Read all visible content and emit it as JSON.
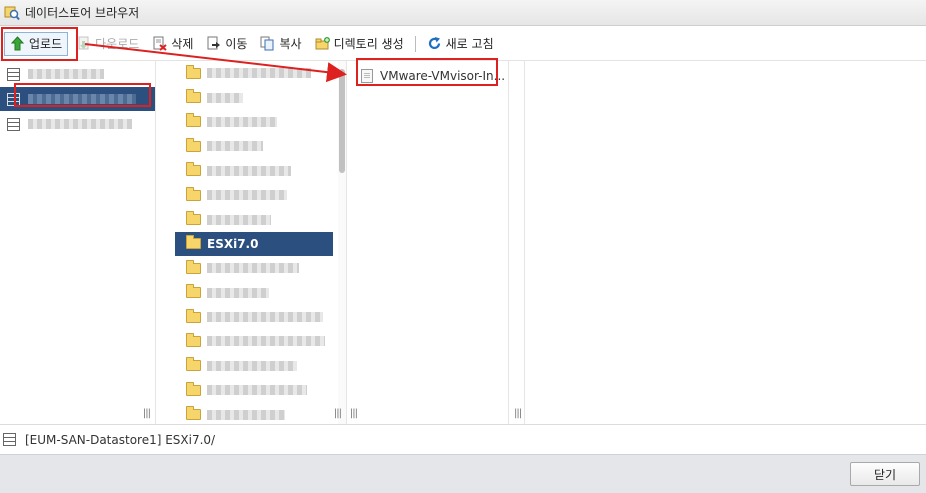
{
  "window": {
    "title": "데이터스토어 브라우저"
  },
  "toolbar": {
    "upload": "업로드",
    "download": "다운로드",
    "delete": "삭제",
    "move": "이동",
    "copy": "복사",
    "create_dir": "디렉토리 생성",
    "refresh": "새로 고침"
  },
  "datastores": [
    {
      "label": "",
      "selected": false
    },
    {
      "label": "",
      "selected": true
    },
    {
      "label": "",
      "selected": false
    }
  ],
  "folders": {
    "selected_label": "ESXi7.0"
  },
  "files": [
    {
      "name": "VMware-VMvisor-In..."
    }
  ],
  "status": {
    "path": "[EUM-SAN-Datastore1] ESXi7.0/"
  },
  "footer": {
    "close_label": "닫기"
  },
  "colors": {
    "selection": "#2b5080",
    "highlight": "#dd2020",
    "accent": "#1f6fc4"
  }
}
